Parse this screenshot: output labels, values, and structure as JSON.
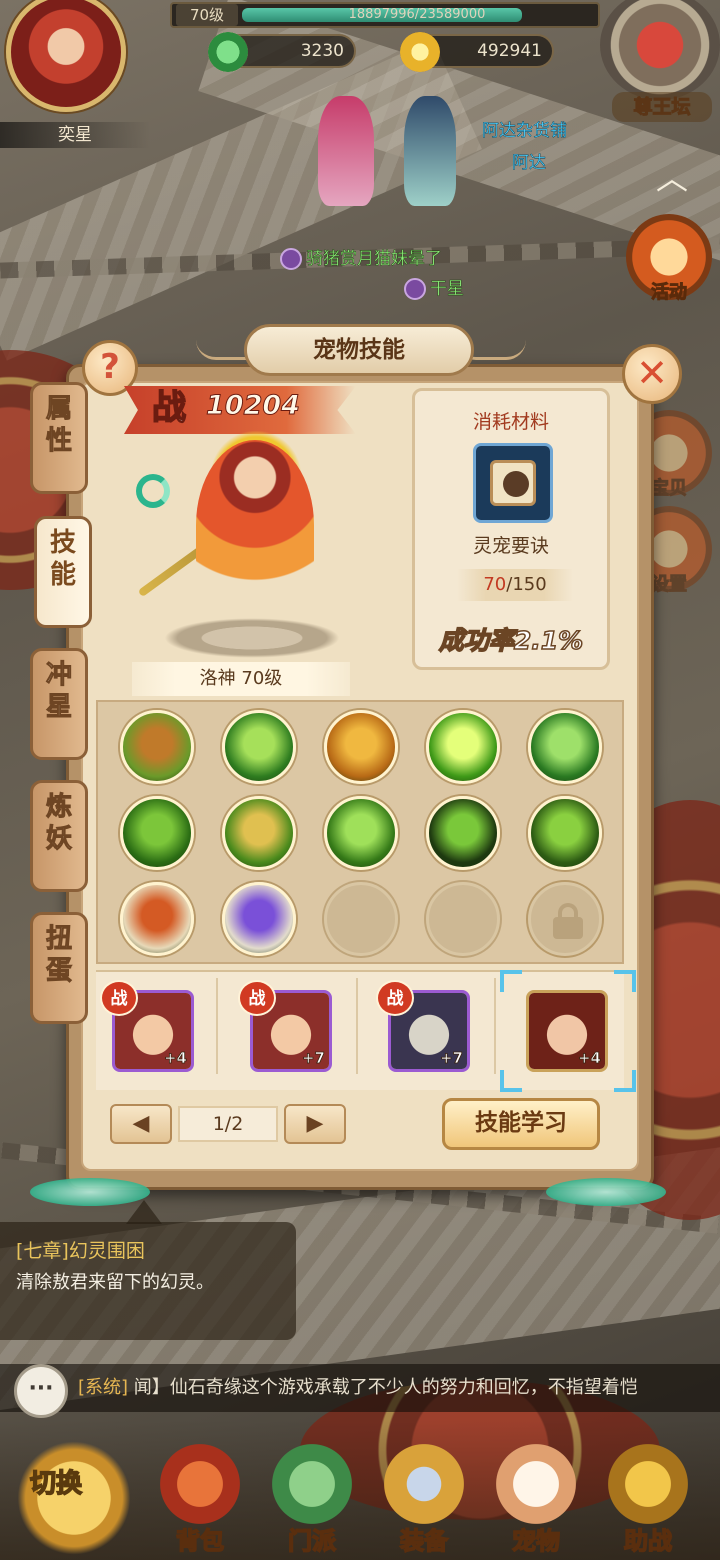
{
  "hud": {
    "player_name": "奕星",
    "level_label": "70级",
    "exp_text": "18897996/23589000",
    "exp_fraction": 0.801,
    "jade": "3230",
    "gold": "492941",
    "altar_label": "尊王坛",
    "side_buttons": [
      "活动",
      "设置"
    ],
    "partial_side_label": "宝贝"
  },
  "scene": {
    "npc_names": [
      "阿达杂货铺",
      "阿达"
    ],
    "player_names": [
      "骑猪赏月猫妹",
      "干星"
    ],
    "overlap_text": "晕了"
  },
  "panel": {
    "title": "宠物技能",
    "help_label": "?",
    "close_label": "✕",
    "tabs": [
      "属性",
      "技能",
      "冲星",
      "炼妖",
      "扭蛋"
    ],
    "active_tab_index": 1,
    "power_icon": "战",
    "power_value": "10204",
    "pet_name": "洛神 70级",
    "material": {
      "title": "消耗材料",
      "icon": "paw-scroll-icon",
      "name": "灵宠要诀",
      "current": "70",
      "max": "150",
      "success_rate": "成功率2.1%"
    },
    "skills": [
      {
        "icon": "earth-guardian-skill-icon",
        "colors": [
          "#6b9a2a",
          "#c07a2a"
        ]
      },
      {
        "icon": "wind-slash-skill-icon",
        "colors": [
          "#2f7d20",
          "#a6e05a"
        ]
      },
      {
        "icon": "golden-buddha-skill-icon",
        "colors": [
          "#b86a16",
          "#f0b840"
        ]
      },
      {
        "icon": "burst-star-skill-icon",
        "colors": [
          "#3f9a18",
          "#e4ff7a"
        ]
      },
      {
        "icon": "bamboo-skill-icon",
        "colors": [
          "#2a7a22",
          "#9ee06a"
        ]
      },
      {
        "icon": "leaf-skill-icon",
        "colors": [
          "#2b6d14",
          "#7cc63a"
        ]
      },
      {
        "icon": "gold-strike-skill-icon",
        "colors": [
          "#4a8a1c",
          "#e0c050"
        ]
      },
      {
        "icon": "grass-blade-skill-icon",
        "colors": [
          "#357a18",
          "#9fe05a"
        ]
      },
      {
        "icon": "shadow-demon-skill-icon",
        "colors": [
          "#1e3a10",
          "#7ac83a"
        ]
      },
      {
        "icon": "beast-eyes-skill-icon",
        "colors": [
          "#2e5d14",
          "#8ad040"
        ]
      },
      {
        "icon": "fire-flame-skill-icon",
        "colors": [
          "#e7d9b8",
          "#d45a24"
        ]
      },
      {
        "icon": "lightning-skill-icon",
        "colors": [
          "#e3dccc",
          "#7a50d8"
        ]
      }
    ],
    "empty_slots": 2,
    "locked_slots": 1,
    "pets": [
      {
        "badge": "战",
        "plus": "+4",
        "face": [
          "#f3c9a5",
          "#8c2f2a"
        ],
        "selected": false
      },
      {
        "badge": "战",
        "plus": "+7",
        "face": [
          "#f3c9a5",
          "#8c2f2a"
        ],
        "selected": false
      },
      {
        "badge": "战",
        "plus": "+7",
        "face": [
          "#d8d4c8",
          "#3a3550"
        ],
        "selected": false
      },
      {
        "badge": "",
        "plus": "+4",
        "face": [
          "#f1c6a6",
          "#6e2218"
        ],
        "selected": true
      }
    ],
    "pager_prev": "◀",
    "pager_next": "▶",
    "pager_text": "1/2",
    "learn_button": "技能学习"
  },
  "quest": {
    "title": "[七章]幻灵围困",
    "desc": "清除敖君来留下的幻灵。"
  },
  "chat": {
    "icon": "···",
    "tag": "[系统]",
    "text": "闻】仙石奇缘这个游戏承载了不少人的努力和回忆，不指望着恺"
  },
  "nav": {
    "switch_label": "切换",
    "items": [
      "背包",
      "门派",
      "装备",
      "宠物",
      "助战"
    ]
  },
  "colors": {
    "panel_bg": "#efe0c2",
    "accent_red": "#c23a22",
    "npc_blue": "#4fd3ff",
    "player_green": "#8dee7a"
  }
}
